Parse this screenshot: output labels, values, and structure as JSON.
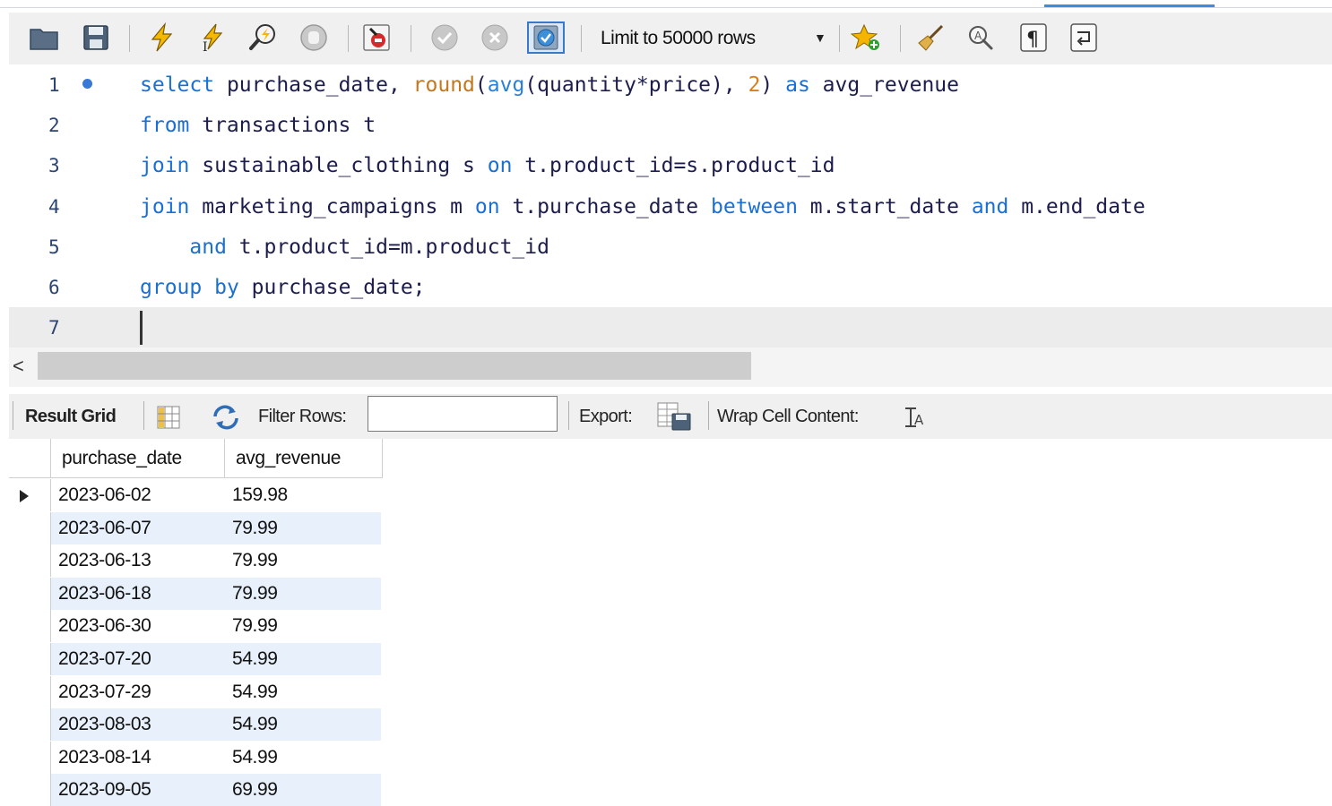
{
  "toolbar": {
    "limit_label": "Limit to 50000 rows"
  },
  "editor": {
    "line_numbers": [
      "1",
      "2",
      "3",
      "4",
      "5",
      "6",
      "7"
    ]
  },
  "result_toolbar": {
    "result_grid_label": "Result Grid",
    "filter_label": "Filter Rows:",
    "filter_value": "",
    "export_label": "Export:",
    "wrap_label": "Wrap Cell Content:"
  },
  "grid": {
    "columns": [
      "purchase_date",
      "avg_revenue"
    ],
    "rows": [
      [
        "2023-06-02",
        "159.98"
      ],
      [
        "2023-06-07",
        "79.99"
      ],
      [
        "2023-06-13",
        "79.99"
      ],
      [
        "2023-06-18",
        "79.99"
      ],
      [
        "2023-06-30",
        "79.99"
      ],
      [
        "2023-07-20",
        "54.99"
      ],
      [
        "2023-07-29",
        "54.99"
      ],
      [
        "2023-08-03",
        "54.99"
      ],
      [
        "2023-08-14",
        "54.99"
      ],
      [
        "2023-09-05",
        "69.99"
      ]
    ]
  },
  "colors": {
    "keyword": "#1a6fd4",
    "function": "#c2781f",
    "alt_row": "#e8f0fb"
  }
}
